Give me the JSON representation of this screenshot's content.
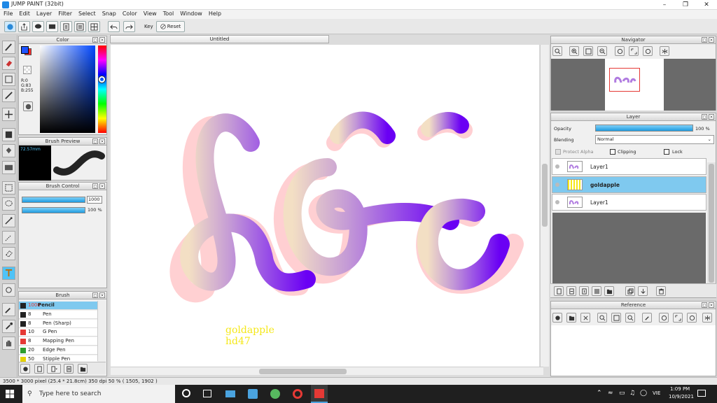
{
  "window": {
    "title": "JUMP PAINT (32bit)",
    "min_icon": "minimize-icon",
    "max_icon": "restore-icon",
    "close_icon": "close-icon"
  },
  "menu": [
    "File",
    "Edit",
    "Layer",
    "Filter",
    "Select",
    "Snap",
    "Color",
    "View",
    "Tool",
    "Window",
    "Help"
  ],
  "toolbar": {
    "key_label": "Key",
    "reset_label": "Reset"
  },
  "color_panel": {
    "title": "Color",
    "r": "R:0",
    "g": "G:83",
    "b": "B:255",
    "fg_color": "#1f53ff",
    "bg_color": "#ff2a2a"
  },
  "brush_preview": {
    "title": "Brush Preview",
    "size_readout": "72.57mm"
  },
  "brush_control": {
    "title": "Brush Control",
    "size_value": "1000",
    "opacity_value": "100 %"
  },
  "brush": {
    "title": "Brush",
    "items": [
      {
        "color": "#222222",
        "size": "1000",
        "name": "Pencil",
        "selected": true
      },
      {
        "color": "#222222",
        "size": "8",
        "name": "Pen",
        "selected": false
      },
      {
        "color": "#222222",
        "size": "8",
        "name": "Pen (Sharp)",
        "selected": false
      },
      {
        "color": "#e53935",
        "size": "10",
        "name": "G Pen",
        "selected": false
      },
      {
        "color": "#e53935",
        "size": "8",
        "name": "Mapping Pen",
        "selected": false
      },
      {
        "color": "#2e9d2e",
        "size": "20",
        "name": "Edge Pen",
        "selected": false
      },
      {
        "color": "#e5d200",
        "size": "50",
        "name": "Stipple Pen",
        "selected": false
      }
    ]
  },
  "document": {
    "tab_title": "Untitled",
    "watermark_line1": "goldapple",
    "watermark_line2": "hd47"
  },
  "navigator": {
    "title": "Navigator"
  },
  "layer_panel": {
    "title": "Layer",
    "opacity_label": "Opacity",
    "opacity_value": "100 %",
    "blending_label": "Blending",
    "blending_value": "Normal",
    "protect_alpha": "Protect Alpha",
    "clipping": "Clipping",
    "lock": "Lock",
    "layers": [
      {
        "name": "Layer1",
        "selected": false
      },
      {
        "name": "goldapple",
        "selected": true
      },
      {
        "name": "Layer1",
        "selected": false
      }
    ]
  },
  "reference": {
    "title": "Reference"
  },
  "status": {
    "text": "3500 * 3000 pixel  (25.4 * 21.8cm)  350 dpi  50 %  ( 1505, 1902 )"
  },
  "taskbar": {
    "search_placeholder": "Type here to search",
    "lang": "VIE",
    "time": "1:09 PM",
    "date": "10/9/2021"
  }
}
